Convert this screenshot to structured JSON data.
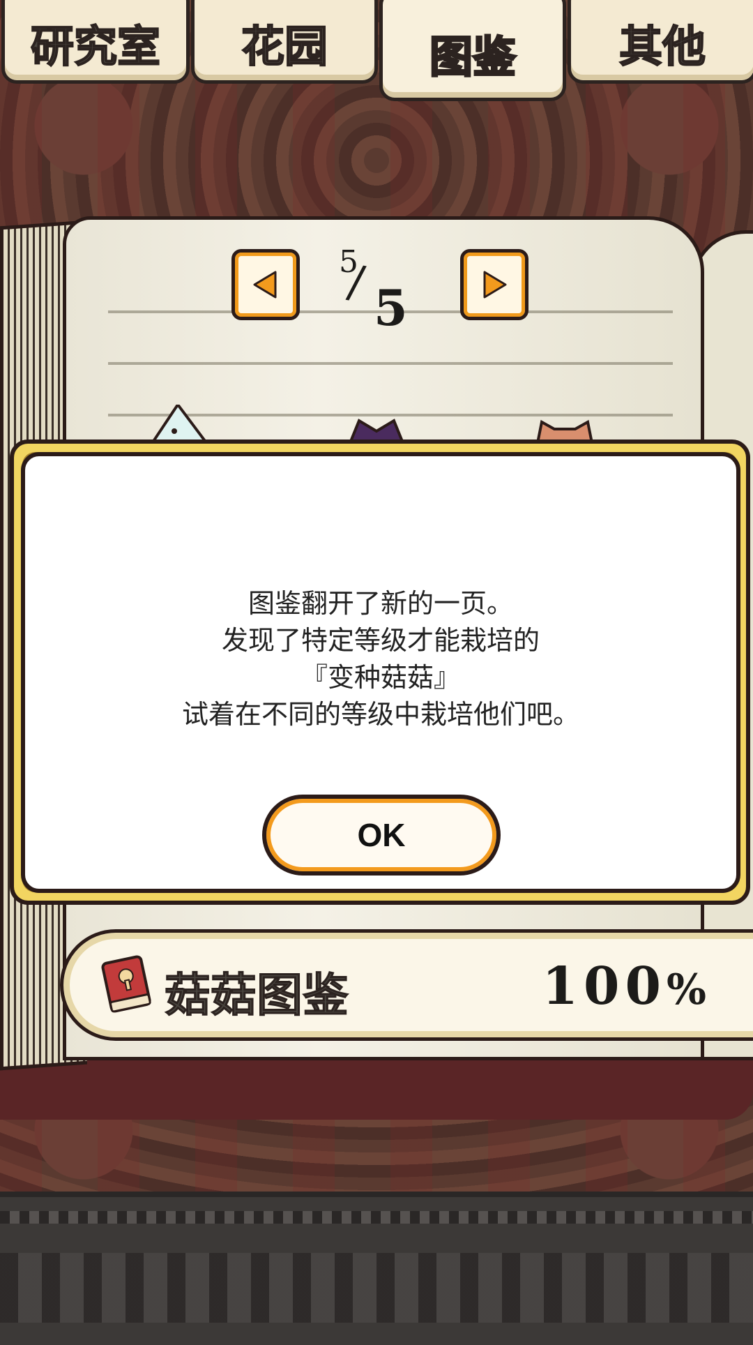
{
  "tabs": [
    {
      "label": "研究室",
      "active": false
    },
    {
      "label": "花园",
      "active": false
    },
    {
      "label": "图鉴",
      "active": true
    },
    {
      "label": "其他",
      "active": false
    }
  ],
  "pager": {
    "current": "5",
    "total": "5"
  },
  "dialog": {
    "lines": [
      "图鉴翻开了新的一页。",
      "发现了特定等级才能栽培的",
      "『变种菇菇』",
      "试着在不同的等级中栽培他们吧。"
    ],
    "ok_label": "OK"
  },
  "completion": {
    "label": "菇菇图鉴",
    "value": "100",
    "unit": "%"
  },
  "colors": {
    "accent": "#f39a1d",
    "gold": "#f2d561",
    "active_tab_text": "#ffd21a"
  }
}
